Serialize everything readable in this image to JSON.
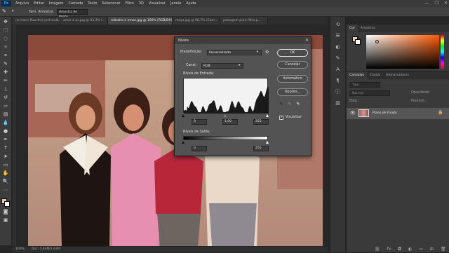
{
  "app": {
    "logo": "Ps"
  },
  "menu": [
    "Arquivo",
    "Editar",
    "Imagem",
    "Camada",
    "Texto",
    "Selecionar",
    "Filtro",
    "3D",
    "Visualizar",
    "Janela",
    "Ajuda"
  ],
  "window_controls": {
    "minimize": "—",
    "maximize": "❐",
    "close": "✕"
  },
  "options_bar": {
    "tool_icon": "eyedropper-icon",
    "sample_label": "Tam. Amostra:",
    "sample_value": "Amostra de Ponto"
  },
  "doc_tabs": [
    {
      "label": "no-more-flow-this-just-walking.jpg",
      "active": false
    },
    {
      "label": "amor e os.jpg @ 83,3% (...",
      "active": false
    },
    {
      "label": "mãezha e irmas.jpg @ 100% (RGB/8#) *",
      "active": true
    },
    {
      "label": "maça.jpg @ 66,7% (Cam...",
      "active": false
    },
    {
      "label": "paisagem para filtro.p...",
      "active": false
    }
  ],
  "status": {
    "zoom": "100%",
    "doc": "Doc: 1,62M/1,62M"
  },
  "color_panel": {
    "tabs": [
      "Cor",
      "Amostras"
    ],
    "fg_color": "#f0c9b6",
    "bg_color": "#ffffff"
  },
  "layers_panel": {
    "tabs": [
      "Camadas",
      "Canais",
      "Demarcadores"
    ],
    "search_placeholder": "Tipo",
    "blend_mode": "Normal",
    "opacity_label": "Opacidade:",
    "fill_label": "Preench.:",
    "lock_label": "Bloq.:",
    "layer_name": "Plano de Fundo"
  },
  "levels_dialog": {
    "title": "Níveis",
    "preset_label": "Predefinição:",
    "preset_value": "Personalizado",
    "channel_label": "Canal:",
    "channel_value": "RGB",
    "input_label": "Níveis de Entrada:",
    "output_label": "Níveis de Saída:",
    "input_black": "0",
    "input_gamma": "1,00",
    "input_white": "255",
    "output_black": "0",
    "output_white": "255",
    "ok": "OK",
    "cancel": "Cancelar",
    "auto": "Automático",
    "options": "Opções...",
    "preview_label": "Visualizar",
    "preview_checked": true
  }
}
